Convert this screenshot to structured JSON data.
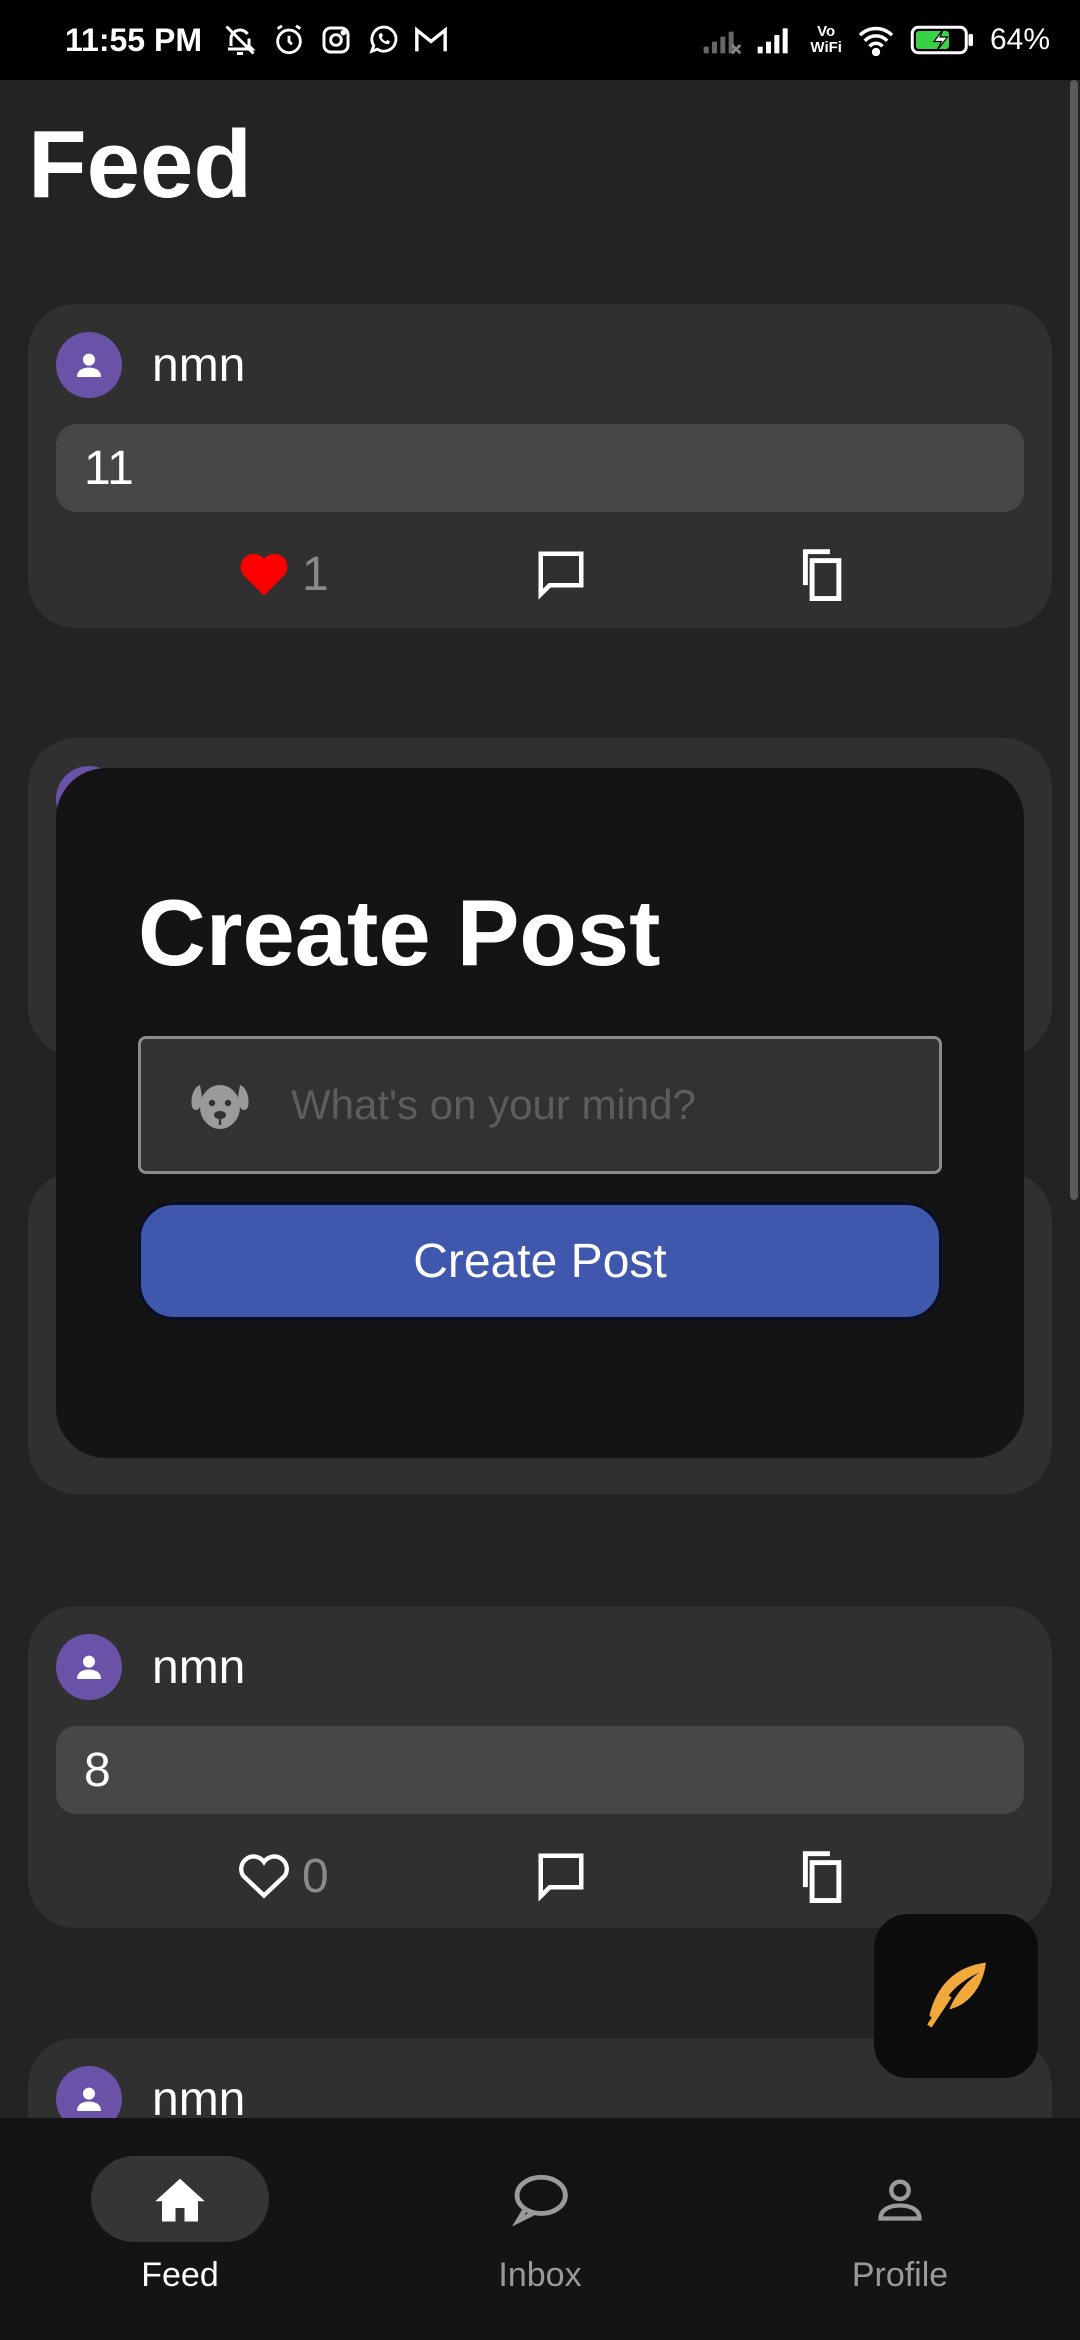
{
  "status_bar": {
    "time": "11:55 PM",
    "battery": "64%",
    "vowifi_top": "Vo",
    "vowifi_bottom": "WiFi",
    "icons": [
      "mute-bell-icon",
      "alarm-icon",
      "instagram-icon",
      "whatsapp-icon",
      "gmail-icon",
      "signal-off-icon",
      "signal-icon",
      "vowifi-icon",
      "wifi-icon",
      "battery-charging-icon"
    ]
  },
  "header": {
    "title": "Feed"
  },
  "posts": [
    {
      "user": "nmn",
      "content": "11",
      "liked": true,
      "likes": "1"
    },
    {
      "user": "nmn",
      "content": "8",
      "liked": false,
      "likes": "0"
    },
    {
      "user": "nmn"
    }
  ],
  "modal": {
    "title": "Create Post",
    "placeholder": "What's on your mind?",
    "value": "",
    "button_label": "Create Post"
  },
  "bottom_nav": [
    {
      "label": "Feed",
      "icon": "home-icon",
      "active": true
    },
    {
      "label": "Inbox",
      "icon": "chat-bubble-icon",
      "active": false
    },
    {
      "label": "Profile",
      "icon": "person-icon",
      "active": false
    }
  ],
  "colors": {
    "background": "#232323",
    "card": "#303030",
    "avatar": "#6a52a8",
    "like_red": "#ff0000",
    "button_blue": "#3f57ac",
    "feather": "#f0a93a"
  }
}
